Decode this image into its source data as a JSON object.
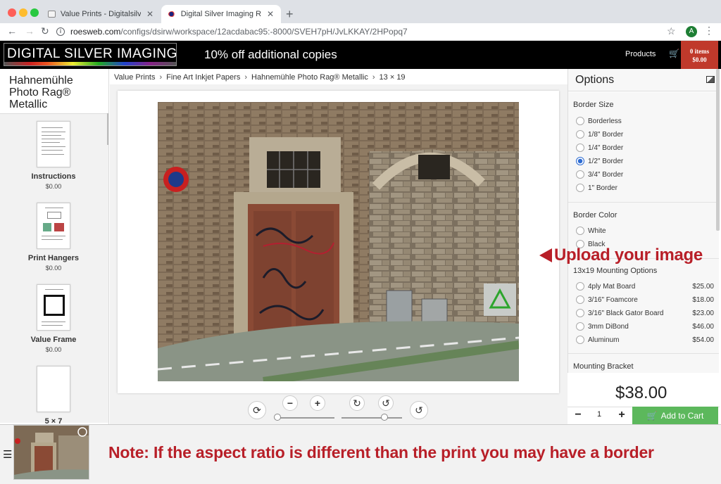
{
  "browser": {
    "tabs": [
      {
        "title": "Value Prints - Digitalsilverimag…",
        "active": false
      },
      {
        "title": "Digital Silver Imaging ROES We…",
        "active": true
      }
    ],
    "url_host": "roesweb.com",
    "url_path": "/configs/dsirw/workspace/12acdabac95:-8000/SVEH7pH/JvLKKAY/2HPopq7",
    "profile_initial": "A"
  },
  "header": {
    "logo_text": "DIGITAL SILVER IMAGING",
    "promo": "10% off additional copies",
    "products_link": "Products",
    "cart_items": "0 items",
    "cart_total": "$0.00"
  },
  "product": {
    "title": "Hahnemühle Photo Rag® Metallic",
    "thumbnails": [
      {
        "name": "Instructions",
        "price": "$0.00"
      },
      {
        "name": "Print Hangers",
        "price": "$0.00"
      },
      {
        "name": "Value Frame",
        "price": "$0.00"
      },
      {
        "name": "5 × 7",
        "price": ""
      }
    ]
  },
  "breadcrumb": [
    "Value Prints",
    "Fine Art Inkjet Papers",
    "Hahnemühle Photo Rag® Metallic",
    "13 × 19"
  ],
  "options": {
    "title": "Options",
    "border_size": {
      "label": "Border Size",
      "items": [
        "Borderless",
        "1/8\" Border",
        "1/4\" Border",
        "1/2\" Border",
        "3/4\" Border",
        "1\" Border"
      ],
      "selected": 3
    },
    "border_color": {
      "label": "Border Color",
      "items": [
        "White",
        "Black"
      ]
    },
    "mounting": {
      "label": "13x19 Mounting Options",
      "items": [
        {
          "name": "4ply Mat Board",
          "price": "$25.00"
        },
        {
          "name": "3/16\" Foamcore",
          "price": "$18.00"
        },
        {
          "name": "3/16\" Black Gator Board",
          "price": "$23.00"
        },
        {
          "name": "3mm DiBond",
          "price": "$46.00"
        },
        {
          "name": "Aluminum",
          "price": "$54.00"
        }
      ]
    },
    "bracket_label": "Mounting Bracket",
    "total": "$38.00",
    "quantity": "1",
    "add_to_cart": "Add to Cart"
  },
  "annotations": {
    "upload": "Upload your image",
    "note": "Note: If the aspect ratio is different than the print you may have a border"
  },
  "colors": {
    "accent_red": "#b81f28",
    "cart_red": "#c0392b",
    "add_green": "#5cb85c",
    "radio_blue": "#2d6bd2"
  }
}
